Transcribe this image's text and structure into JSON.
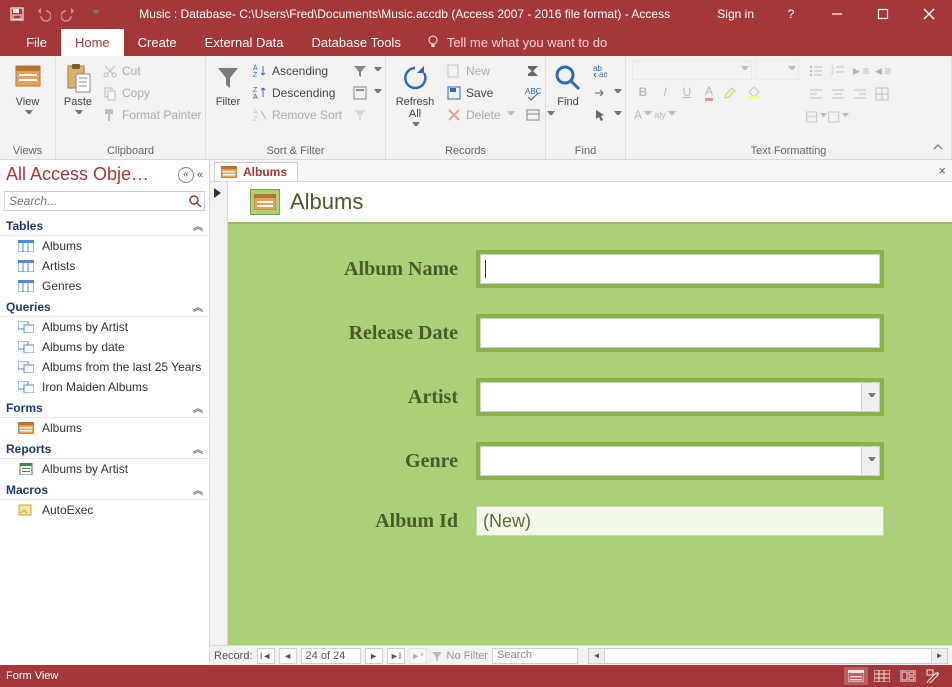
{
  "titlebar": {
    "title": "Music : Database- C:\\Users\\Fred\\Documents\\Music.accdb (Access 2007 - 2016 file format) - Access",
    "signin": "Sign in"
  },
  "tabs": {
    "file": "File",
    "home": "Home",
    "create": "Create",
    "external": "External Data",
    "dbtools": "Database Tools",
    "tellme": "Tell me what you want to do"
  },
  "ribbon": {
    "views": {
      "view": "View",
      "group": "Views"
    },
    "clipboard": {
      "paste": "Paste",
      "cut": "Cut",
      "copy": "Copy",
      "painter": "Format Painter",
      "group": "Clipboard"
    },
    "sortfilter": {
      "filter": "Filter",
      "asc": "Ascending",
      "desc": "Descending",
      "remove": "Remove Sort",
      "group": "Sort & Filter"
    },
    "records": {
      "refresh": "Refresh All",
      "new": "New",
      "save": "Save",
      "delete": "Delete",
      "group": "Records"
    },
    "find": {
      "find": "Find",
      "group": "Find"
    },
    "textfmt": {
      "group": "Text Formatting"
    }
  },
  "nav": {
    "header": "All Access Obje…",
    "search_placeholder": "Search...",
    "groups": {
      "tables": "Tables",
      "queries": "Queries",
      "forms": "Forms",
      "reports": "Reports",
      "macros": "Macros"
    },
    "tables": [
      "Albums",
      "Artists",
      "Genres"
    ],
    "queries": [
      "Albums by Artist",
      "Albums by date",
      "Albums from the last 25 Years",
      "Iron Maiden Albums"
    ],
    "forms": [
      "Albums"
    ],
    "reports": [
      "Albums by Artist"
    ],
    "macros": [
      "AutoExec"
    ]
  },
  "doc": {
    "tab": "Albums",
    "header": "Albums",
    "fields": {
      "album_name": "Album Name",
      "release_date": "Release Date",
      "artist": "Artist",
      "genre": "Genre",
      "album_id": "Album Id",
      "album_id_value": "(New)"
    }
  },
  "recnav": {
    "label": "Record:",
    "pos": "24 of 24",
    "nofilter": "No Filter",
    "search": "Search"
  },
  "status": {
    "left": "Form View"
  }
}
